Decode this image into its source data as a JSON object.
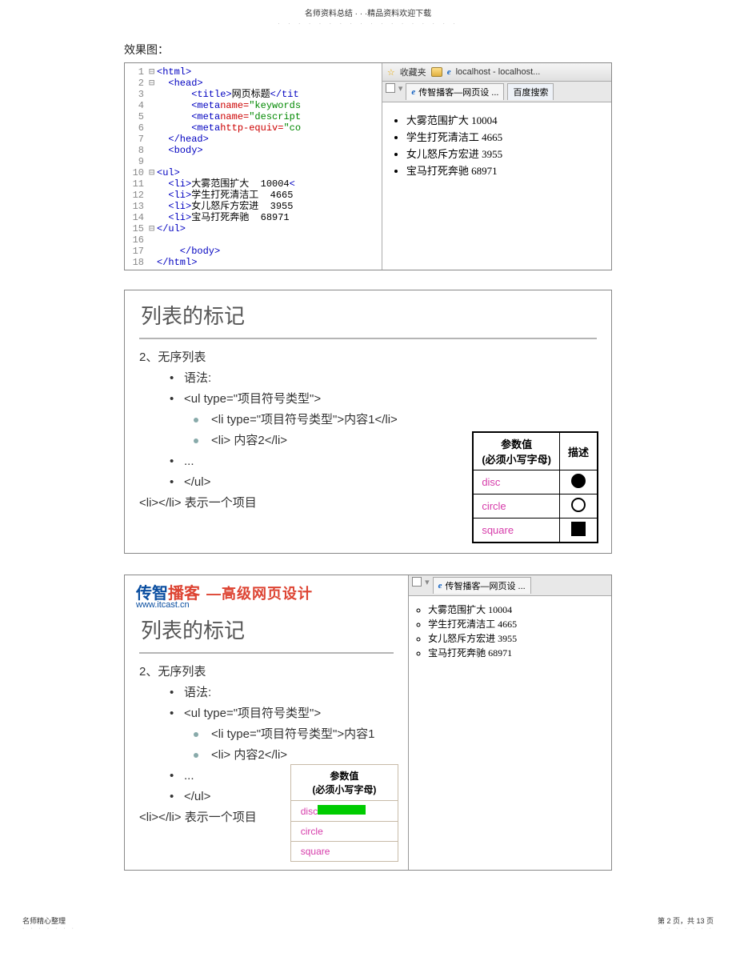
{
  "header": "名师资料总结 · · ·精品资料欢迎下载",
  "caption": "效果图：",
  "code": {
    "lines": [
      {
        "n": "1",
        "f": "⊟",
        "html": "<html>"
      },
      {
        "n": "2",
        "f": "⊟",
        "html": "  <head>"
      },
      {
        "n": "3",
        "f": "",
        "html": "    <title>网页标题</tit"
      },
      {
        "n": "4",
        "f": "",
        "html": "    <meta name=\"keywords"
      },
      {
        "n": "5",
        "f": "",
        "html": "    <meta name=\"descript"
      },
      {
        "n": "6",
        "f": "",
        "html": "    <meta http-equiv=\"co"
      },
      {
        "n": "7",
        "f": "",
        "html": "  </head>"
      },
      {
        "n": "8",
        "f": "",
        "html": "  <body>"
      },
      {
        "n": "9",
        "f": "",
        "html": ""
      },
      {
        "n": "10",
        "f": "⊟",
        "html": "<ul>"
      },
      {
        "n": "11",
        "f": "",
        "html": "  <li>大雾范围扩大  10004<"
      },
      {
        "n": "12",
        "f": "",
        "html": "  <li>学生打死清洁工  4665"
      },
      {
        "n": "13",
        "f": "",
        "html": "  <li>女儿怒斥方宏进  3955"
      },
      {
        "n": "14",
        "f": "",
        "html": "  <li>宝马打死奔驰  68971"
      },
      {
        "n": "15",
        "f": "⊟",
        "html": "</ul>"
      },
      {
        "n": "16",
        "f": "",
        "html": ""
      },
      {
        "n": "17",
        "f": "",
        "html": "    </body>"
      },
      {
        "n": "18",
        "f": "",
        "html": "</html>"
      }
    ]
  },
  "favbar": {
    "star": "☆",
    "label": "收藏夹",
    "loc": "localhost - localhost..."
  },
  "tab1": "传智播客—网页设 ...",
  "tab2": "百度搜索",
  "preview_items": [
    "大雾范围扩大 10004",
    "学生打死清洁工 4665",
    "女儿怒斥方宏进 3955",
    "宝马打死奔驰 68971"
  ],
  "slide": {
    "title": "列表的标记",
    "l1": "2、无序列表",
    "l2": "语法:",
    "l3": "<ul type=\"项目符号类型\">",
    "l4": "<li type=\"项目符号类型\">内容1</li>",
    "l5": "<li> 内容2</li>",
    "l6": "...",
    "l7": "</ul>",
    "l8": "<li></li> 表示一个项目"
  },
  "table": {
    "h1": "参数值",
    "h1b": "(必须小写字母)",
    "h2": "描述",
    "r1": "disc",
    "r2": "circle",
    "r3": "square"
  },
  "slide3_l4": "<li type=\"项目符号类型\">内容1",
  "logo": {
    "blue": "传智",
    "red": "播客",
    "url": "www.itcast.cn",
    "right": "—高级网页设计"
  },
  "footer_left": "名师精心整理",
  "footer_right": "第 2 页，共 13 页"
}
